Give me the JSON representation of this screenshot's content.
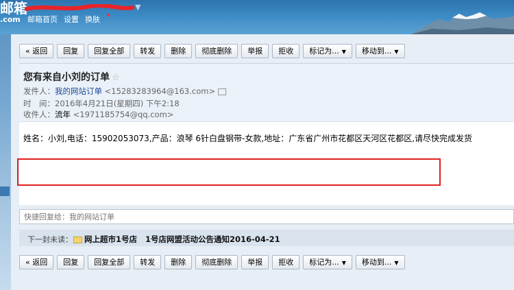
{
  "header": {
    "logo": "邮箱",
    "logo_domain": ".com",
    "nav": [
      "邮箱首页",
      "设置",
      "换肤"
    ]
  },
  "toolbar": {
    "back": "« 返回",
    "reply": "回复",
    "reply_all": "回复全部",
    "forward": "转发",
    "delete": "删除",
    "delete_perm": "彻底删除",
    "report": "举报",
    "reject": "拒收",
    "mark_as": "标记为...",
    "move_to": "移动到..."
  },
  "mail": {
    "subject": "您有来自小刘的订单",
    "from_label": "发件人：",
    "from_name": "我的网站订单",
    "from_addr": "<15283283964@163.com>",
    "time_label": "时　间：",
    "time_value": "2016年4月21日(星期四) 下午2:18",
    "to_label": "收件人：",
    "to_name": "流年",
    "to_addr": "<1971185754@qq.com>",
    "body": "姓名：小刘,电话：15902053073,产品：浪琴 6针白盘钢带-女款,地址：广东省广州市花都区天河区花都区,请尽快完成发货"
  },
  "quick_reply": {
    "placeholder": "快捷回复给：我的网站订单"
  },
  "next_unread": {
    "label": "下一封未读：",
    "sender": "网上超市1号店",
    "subject": "1号店网盟活动公告通知2016-04-21"
  },
  "colors": {
    "topbar": "#3c8ac4",
    "highlight_box": "#e02020",
    "link": "#1a4b99"
  }
}
